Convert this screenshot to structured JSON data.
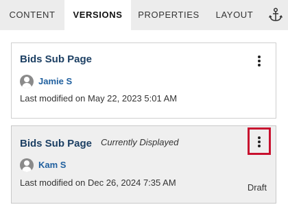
{
  "tabs": {
    "content": "CONTENT",
    "versions": "VERSIONS",
    "properties": "PROPERTIES",
    "layout": "LAYOUT",
    "active": "versions"
  },
  "versions": [
    {
      "title": "Bids Sub Page",
      "current_label": "",
      "user": "Jamie S",
      "modified": "Last modified on May 22, 2023 5:01 AM",
      "status": ""
    },
    {
      "title": "Bids Sub Page",
      "current_label": "Currently Displayed",
      "user": "Kam S",
      "modified": "Last modified on Dec 26, 2024 7:35 AM",
      "status": "Draft"
    }
  ],
  "icons": {
    "tab_extra": "anchor-icon",
    "menu": "kebab-menu-icon",
    "user": "user-avatar-icon"
  },
  "colors": {
    "title": "#1c3f63",
    "user_link": "#1f5f9e",
    "highlight_box": "#c8102e",
    "tab_bar": "#ececec",
    "selected_card": "#efefef"
  }
}
